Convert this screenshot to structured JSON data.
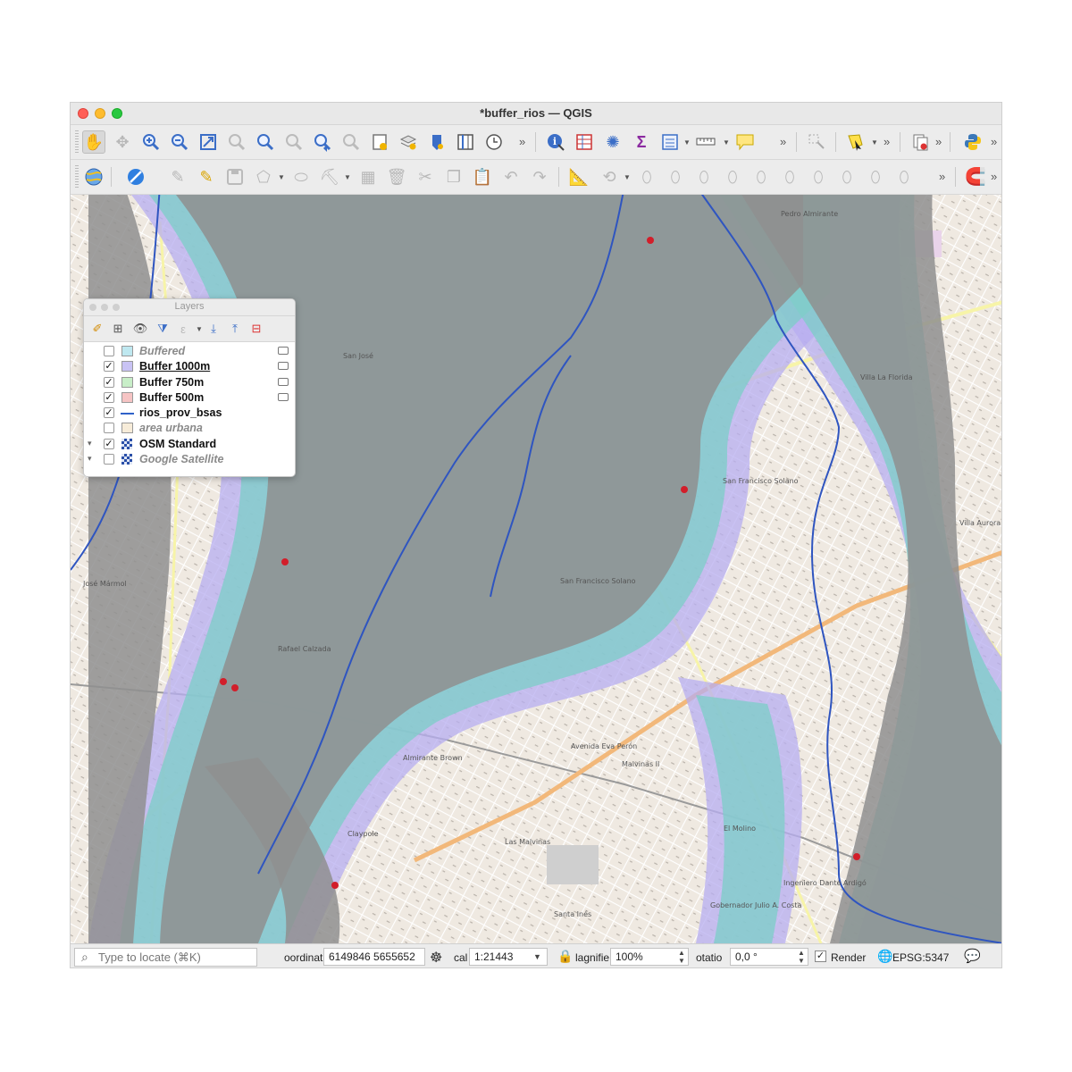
{
  "window": {
    "title": "*buffer_rios — QGIS"
  },
  "toolbar1": {
    "icons": [
      "pan-hand-icon",
      "pan-to-selection-icon",
      "zoom-in-icon",
      "zoom-out-icon",
      "zoom-full-icon",
      "zoom-to-selection-icon",
      "zoom-to-layer-icon",
      "zoom-native-icon",
      "zoom-last-icon",
      "zoom-next-icon",
      "new-bookmark-icon",
      "show-bookmarks-icon",
      "refresh-icon",
      "temporal-controller-icon",
      "clock-icon",
      "identify-icon",
      "attribute-table-icon",
      "settings-icon",
      "statistics-sum-icon",
      "open-table-icon",
      "measure-icon",
      "map-tips-icon",
      "select-icon",
      "select-feature-icon",
      "deselect-icon",
      "python-icon"
    ]
  },
  "toolbar2": {
    "icons": [
      "digitize-icon",
      "no-action-icon",
      "edit-pencil-icon",
      "save-edits-icon",
      "add-polygon-icon",
      "vertex-tool-icon",
      "copy-icon",
      "paste-icon",
      "undo-icon",
      "redo-icon",
      "magnet-icon"
    ]
  },
  "layers_panel": {
    "title": "Layers",
    "layers": [
      {
        "name": "Buffered",
        "checked": false,
        "visible": false,
        "swatch": "#bfe8f0",
        "kind": "fill"
      },
      {
        "name": "Buffer 1000m",
        "checked": true,
        "visible": true,
        "swatch": "#c9c3f4",
        "kind": "fill",
        "selected": true
      },
      {
        "name": "Buffer 750m",
        "checked": true,
        "visible": true,
        "swatch": "#c8eec8",
        "kind": "fill"
      },
      {
        "name": "Buffer 500m",
        "checked": true,
        "visible": true,
        "swatch": "#f6c4c4",
        "kind": "fill"
      },
      {
        "name": "rios_prov_bsas",
        "checked": true,
        "visible": true,
        "swatch": "#2f62c9",
        "kind": "line"
      },
      {
        "name": "area urbana",
        "checked": false,
        "visible": false,
        "swatch": "#f7ecd9",
        "kind": "fill"
      },
      {
        "name": "OSM Standard",
        "checked": true,
        "visible": true,
        "kind": "raster",
        "expand": "▾"
      },
      {
        "name": "Google Satellite",
        "checked": false,
        "visible": false,
        "kind": "raster",
        "expand": "▾"
      }
    ]
  },
  "map": {
    "labels": [
      "San José",
      "Villa La Florida",
      "San Francisco Solano",
      "José Mármol",
      "Rafael Calzada",
      "Claypole",
      "Villa Aurora",
      "El Molino",
      "Malvinas II",
      "Las Malvinas",
      "Santa Inés",
      "Gobernador Julio A. Costa",
      "Ingeniero Dante Ardigó",
      "Almirante Brown",
      "Avenida Eva Perón",
      "Pedro Almirante"
    ]
  },
  "statusbar": {
    "locate_placeholder": "Type to locate (⌘K)",
    "coord_label": "oordinat",
    "coord_value": "6149846  5655652",
    "scale_label": "cal",
    "scale_value": "1:21443",
    "magnifier_label": "lagnifie",
    "magnifier_value": "100%",
    "rotation_label": "otatio",
    "rotation_value": "0,0 °",
    "render_label": "Render",
    "crs_label": "EPSG:5347"
  }
}
